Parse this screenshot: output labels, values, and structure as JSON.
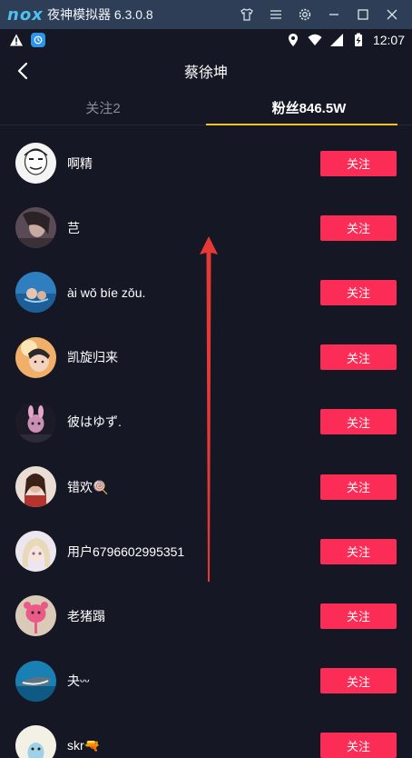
{
  "emulator": {
    "logo": "nox",
    "title": "夜神模拟器 6.3.0.8",
    "controls": [
      "shirt-icon",
      "menu-icon",
      "gear-icon",
      "minimize-icon",
      "maximize-icon",
      "close-icon"
    ]
  },
  "status_bar": {
    "time": "12:07",
    "icons": [
      "warning-icon",
      "app-notification-icon",
      "location-icon",
      "wifi-icon",
      "signal-icon",
      "battery-charging-icon"
    ]
  },
  "header": {
    "title": "蔡徐坤"
  },
  "tabs": [
    {
      "label": "关注2",
      "active": false
    },
    {
      "label": "粉丝846.5W",
      "active": true
    }
  ],
  "followers": [
    {
      "name": "啊精",
      "button": "关注"
    },
    {
      "name": "芑",
      "button": "关注"
    },
    {
      "name": "ài wǒ bíe zǒu.",
      "button": "关注"
    },
    {
      "name": "凯旋归来",
      "button": "关注"
    },
    {
      "name": "彼はゆず.",
      "button": "关注"
    },
    {
      "name": "错欢🍭",
      "button": "关注"
    },
    {
      "name": "用户6796602995351",
      "button": "关注"
    },
    {
      "name": "老猪蹋",
      "button": "关注"
    },
    {
      "name": "夬ᵕᵕ",
      "button": "关注"
    },
    {
      "name": "skr🔫",
      "button": "关注"
    }
  ],
  "colors": {
    "background": "#161724",
    "follow_button": "#fb2c55",
    "tab_indicator": "#f3c321",
    "annotation_arrow": "#e53935"
  }
}
